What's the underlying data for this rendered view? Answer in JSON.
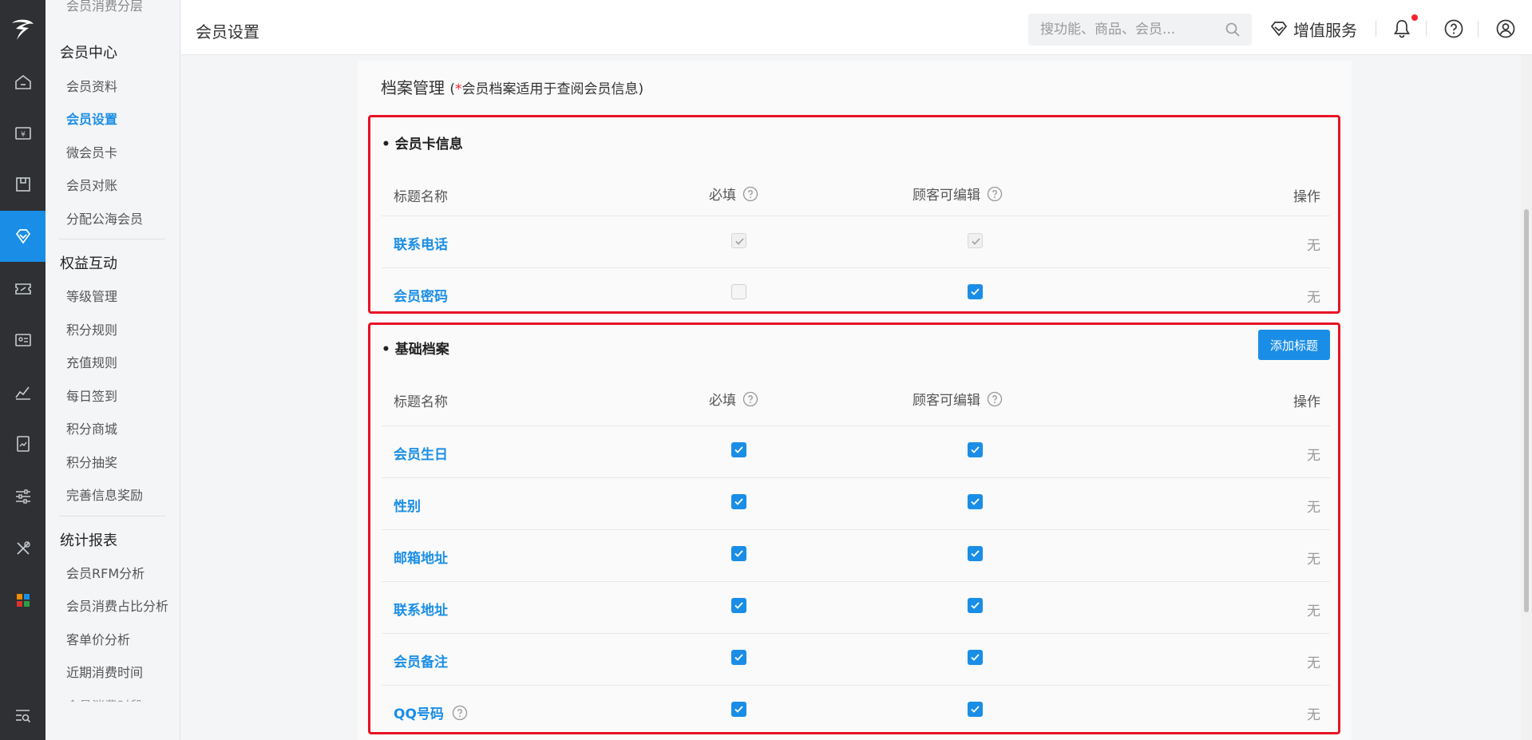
{
  "header": {
    "page_title": "会员设置",
    "search_placeholder": "搜功能、商品、会员...",
    "value_added_service": "增值服务"
  },
  "sidebar": {
    "partial_top": "会员消费分层",
    "groups": [
      {
        "title": "会员中心",
        "items": [
          "会员资料",
          "会员设置",
          "微会员卡",
          "会员对账",
          "分配公海会员"
        ]
      },
      {
        "title": "权益互动",
        "items": [
          "等级管理",
          "积分规则",
          "充值规则",
          "每日签到",
          "积分商城",
          "积分抽奖",
          "完善信息奖励"
        ]
      },
      {
        "title": "统计报表",
        "items": [
          "会员RFM分析",
          "会员消费占比分析",
          "客单价分析",
          "近期消费时间"
        ]
      }
    ],
    "partial_bottom": "会员消费时段",
    "active_item": "会员设置"
  },
  "archive": {
    "title": "档案管理",
    "note_star": "*",
    "note_text": "会员档案适用于查阅会员信息",
    "note_open": "(",
    "note_close": ")"
  },
  "table_headers": {
    "name": "标题名称",
    "required": "必填",
    "editable": "顾客可编辑",
    "operation": "操作"
  },
  "card_info": {
    "title": "• 会员卡信息",
    "rows": [
      {
        "name": "联系电话",
        "required": "disabled-checked",
        "editable": "disabled-checked",
        "op": "无"
      },
      {
        "name": "会员密码",
        "required": "unchecked",
        "editable": "checked",
        "op": "无"
      }
    ]
  },
  "basic_archive": {
    "title": "• 基础档案",
    "add_button": "添加标题",
    "rows": [
      {
        "name": "会员生日",
        "required": "checked",
        "editable": "checked",
        "op": "无"
      },
      {
        "name": "性别",
        "required": "checked",
        "editable": "checked",
        "op": "无"
      },
      {
        "name": "邮箱地址",
        "required": "checked",
        "editable": "checked",
        "op": "无"
      },
      {
        "name": "联系地址",
        "required": "checked",
        "editable": "checked",
        "op": "无"
      },
      {
        "name": "会员备注",
        "required": "checked",
        "editable": "checked",
        "op": "无"
      },
      {
        "name": "QQ号码",
        "required": "checked",
        "editable": "checked",
        "op": "无"
      }
    ]
  },
  "colors": {
    "accent": "#1a8ee6",
    "highlight_border": "#e81225",
    "rail_bg": "#2e3033",
    "notification_dot": "#f5222d"
  }
}
